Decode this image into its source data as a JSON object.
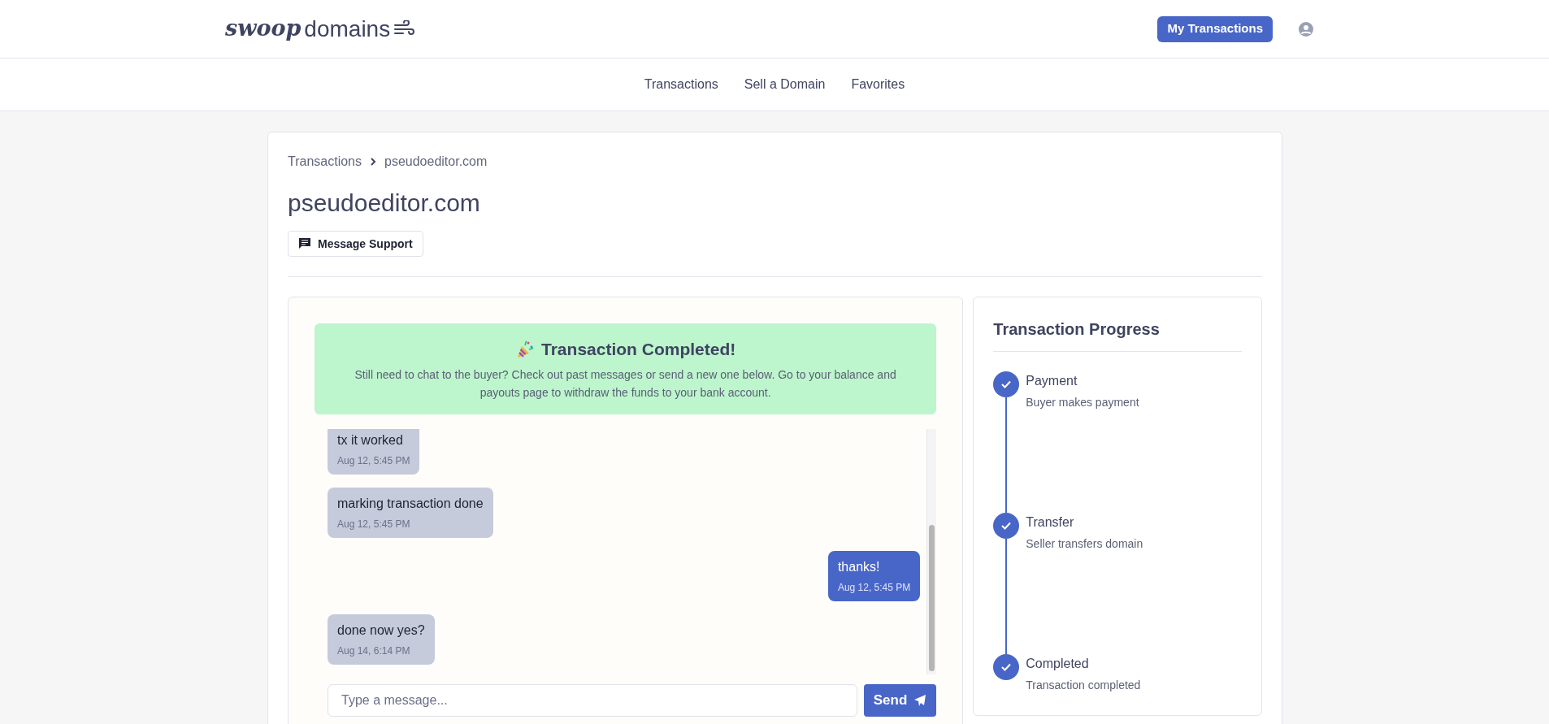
{
  "header": {
    "logo": {
      "script": "swoop",
      "text": "domains"
    },
    "button": "My Transactions"
  },
  "nav": [
    "Transactions",
    "Sell a Domain",
    "Favorites"
  ],
  "breadcrumb": [
    "Transactions",
    "pseudoeditor.com"
  ],
  "title": "pseudoeditor.com",
  "support_button": "Message Support",
  "banner": {
    "title": "Transaction Completed!",
    "text": "Still need to chat to the buyer? Check out past messages or send a new one below. Go to your balance and payouts page to withdraw the funds to your bank account."
  },
  "messages": [
    {
      "kind": "received",
      "text": "tx it worked",
      "time": "Aug 12, 5:45 PM"
    },
    {
      "kind": "received",
      "text": "marking transaction done",
      "time": "Aug 12, 5:45 PM"
    },
    {
      "kind": "sent",
      "text": "thanks!",
      "time": "Aug 12, 5:45 PM"
    },
    {
      "kind": "received",
      "text": "done now yes?",
      "time": "Aug 14, 6:14 PM"
    }
  ],
  "composer": {
    "placeholder": "Type a message...",
    "button": "Send"
  },
  "progress": {
    "title": "Transaction Progress",
    "steps": [
      {
        "label": "Payment",
        "detail": "Buyer makes payment",
        "done": true
      },
      {
        "label": "Transfer",
        "detail": "Seller transfers domain",
        "done": true
      },
      {
        "label": "Completed",
        "detail": "Transaction completed",
        "done": true
      }
    ]
  }
}
